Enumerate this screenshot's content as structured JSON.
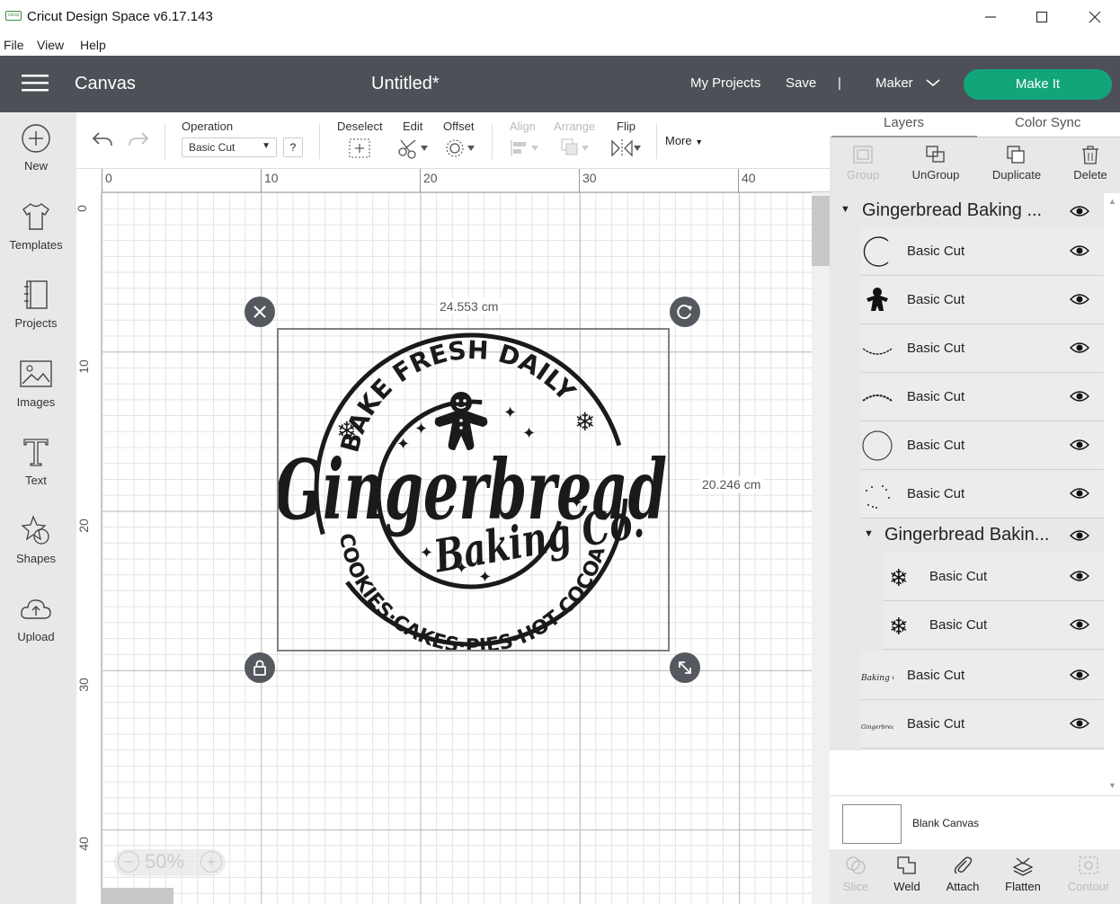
{
  "window": {
    "title": "Cricut Design Space  v6.17.143",
    "logo_text": "cricut",
    "buttons": [
      "minimize-icon",
      "maximize-icon",
      "close-icon"
    ]
  },
  "menu": [
    "File",
    "View",
    "Help"
  ],
  "header": {
    "section": "Canvas",
    "project": "Untitled*",
    "my_projects": "My Projects",
    "save": "Save",
    "divider": "|",
    "machine": "Maker",
    "make_it": "Make It",
    "accent": "#13a57a",
    "bg": "#4d5157"
  },
  "leftbar": [
    {
      "label": "New",
      "icon": "plus-circle-icon"
    },
    {
      "label": "Templates",
      "icon": "tshirt-icon"
    },
    {
      "label": "Projects",
      "icon": "book-icon"
    },
    {
      "label": "Images",
      "icon": "image-icon"
    },
    {
      "label": "Text",
      "icon": "text-icon"
    },
    {
      "label": "Shapes",
      "icon": "shapes-icon"
    },
    {
      "label": "Upload",
      "icon": "cloud-upload-icon"
    }
  ],
  "toolbar": {
    "operation_label": "Operation",
    "operation_value": "Basic Cut",
    "help": "?",
    "deselect": "Deselect",
    "edit": "Edit",
    "offset": "Offset",
    "align": "Align",
    "arrange": "Arrange",
    "flip": "Flip",
    "more": "More"
  },
  "ruler": {
    "h": [
      "0",
      "10",
      "20",
      "30",
      "40"
    ],
    "v": [
      "0",
      "10",
      "20",
      "30",
      "40"
    ]
  },
  "selection": {
    "width": "24.553 cm",
    "height": "20.246 cm"
  },
  "design": {
    "top_arc": "BAKE FRESH DAILY",
    "main": "Gingerbread",
    "sub": "Baking Co.",
    "bottom_arc": "COOKIES·CAKES·PIES·HOT COCOA"
  },
  "zoom": {
    "value": "50%",
    "minus": "−",
    "plus": "+"
  },
  "panel": {
    "tabs": [
      "Layers",
      "Color Sync"
    ],
    "tools": [
      {
        "label": "Group",
        "icon": "group-icon",
        "enabled": false
      },
      {
        "label": "UnGroup",
        "icon": "ungroup-icon",
        "enabled": true
      },
      {
        "label": "Duplicate",
        "icon": "duplicate-icon",
        "enabled": true
      },
      {
        "label": "Delete",
        "icon": "trash-icon",
        "enabled": true
      }
    ],
    "group1": "Gingerbread Baking ...",
    "layers1": [
      {
        "name": "Basic Cut",
        "thumb": "arc-left"
      },
      {
        "name": "Basic Cut",
        "thumb": "gingerbread-man"
      },
      {
        "name": "Basic Cut",
        "thumb": "arc-bottom"
      },
      {
        "name": "Basic Cut",
        "thumb": "arc-top-text"
      },
      {
        "name": "Basic Cut",
        "thumb": "circle"
      },
      {
        "name": "Basic Cut",
        "thumb": "stars"
      }
    ],
    "group2": "Gingerbread Bakin...",
    "layers2": [
      {
        "name": "Basic Cut",
        "thumb": "snowflake"
      },
      {
        "name": "Basic Cut",
        "thumb": "snowflake"
      }
    ],
    "layers3": [
      {
        "name": "Basic Cut",
        "thumb": "baking-co-text",
        "thumb_text": "Baking Co."
      },
      {
        "name": "Basic Cut",
        "thumb": "gingerbread-text",
        "thumb_text": "Gingerbread"
      }
    ],
    "blank_canvas": "Blank Canvas",
    "bottom_tools": [
      {
        "label": "Slice",
        "icon": "slice-icon",
        "enabled": false
      },
      {
        "label": "Weld",
        "icon": "weld-icon",
        "enabled": true
      },
      {
        "label": "Attach",
        "icon": "paperclip-icon",
        "enabled": true
      },
      {
        "label": "Flatten",
        "icon": "flatten-icon",
        "enabled": true
      },
      {
        "label": "Contour",
        "icon": "contour-icon",
        "enabled": false
      }
    ]
  }
}
